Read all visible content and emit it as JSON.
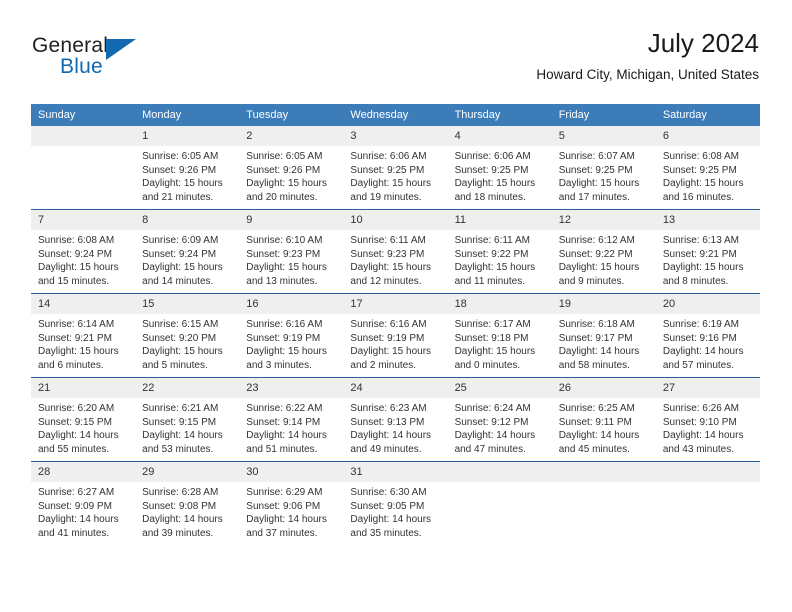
{
  "brand": {
    "name_part1": "General",
    "name_part2": "Blue",
    "logo_icon": "triangle-icon"
  },
  "header": {
    "title": "July 2024",
    "subtitle": "Howard City, Michigan, United States"
  },
  "calendar": {
    "weekday_headers": [
      "Sunday",
      "Monday",
      "Tuesday",
      "Wednesday",
      "Thursday",
      "Friday",
      "Saturday"
    ],
    "accent_color": "#3b7cb9",
    "daynum_band_color": "#efefef",
    "row_divider_color": "#2a6099",
    "weeks": [
      [
        {
          "day": "",
          "empty": true,
          "sunrise": "",
          "sunset": "",
          "daylight_line1": "",
          "daylight_line2": ""
        },
        {
          "day": "1",
          "empty": false,
          "sunrise": "Sunrise: 6:05 AM",
          "sunset": "Sunset: 9:26 PM",
          "daylight_line1": "Daylight: 15 hours",
          "daylight_line2": "and 21 minutes."
        },
        {
          "day": "2",
          "empty": false,
          "sunrise": "Sunrise: 6:05 AM",
          "sunset": "Sunset: 9:26 PM",
          "daylight_line1": "Daylight: 15 hours",
          "daylight_line2": "and 20 minutes."
        },
        {
          "day": "3",
          "empty": false,
          "sunrise": "Sunrise: 6:06 AM",
          "sunset": "Sunset: 9:25 PM",
          "daylight_line1": "Daylight: 15 hours",
          "daylight_line2": "and 19 minutes."
        },
        {
          "day": "4",
          "empty": false,
          "sunrise": "Sunrise: 6:06 AM",
          "sunset": "Sunset: 9:25 PM",
          "daylight_line1": "Daylight: 15 hours",
          "daylight_line2": "and 18 minutes."
        },
        {
          "day": "5",
          "empty": false,
          "sunrise": "Sunrise: 6:07 AM",
          "sunset": "Sunset: 9:25 PM",
          "daylight_line1": "Daylight: 15 hours",
          "daylight_line2": "and 17 minutes."
        },
        {
          "day": "6",
          "empty": false,
          "sunrise": "Sunrise: 6:08 AM",
          "sunset": "Sunset: 9:25 PM",
          "daylight_line1": "Daylight: 15 hours",
          "daylight_line2": "and 16 minutes."
        }
      ],
      [
        {
          "day": "7",
          "empty": false,
          "sunrise": "Sunrise: 6:08 AM",
          "sunset": "Sunset: 9:24 PM",
          "daylight_line1": "Daylight: 15 hours",
          "daylight_line2": "and 15 minutes."
        },
        {
          "day": "8",
          "empty": false,
          "sunrise": "Sunrise: 6:09 AM",
          "sunset": "Sunset: 9:24 PM",
          "daylight_line1": "Daylight: 15 hours",
          "daylight_line2": "and 14 minutes."
        },
        {
          "day": "9",
          "empty": false,
          "sunrise": "Sunrise: 6:10 AM",
          "sunset": "Sunset: 9:23 PM",
          "daylight_line1": "Daylight: 15 hours",
          "daylight_line2": "and 13 minutes."
        },
        {
          "day": "10",
          "empty": false,
          "sunrise": "Sunrise: 6:11 AM",
          "sunset": "Sunset: 9:23 PM",
          "daylight_line1": "Daylight: 15 hours",
          "daylight_line2": "and 12 minutes."
        },
        {
          "day": "11",
          "empty": false,
          "sunrise": "Sunrise: 6:11 AM",
          "sunset": "Sunset: 9:22 PM",
          "daylight_line1": "Daylight: 15 hours",
          "daylight_line2": "and 11 minutes."
        },
        {
          "day": "12",
          "empty": false,
          "sunrise": "Sunrise: 6:12 AM",
          "sunset": "Sunset: 9:22 PM",
          "daylight_line1": "Daylight: 15 hours",
          "daylight_line2": "and 9 minutes."
        },
        {
          "day": "13",
          "empty": false,
          "sunrise": "Sunrise: 6:13 AM",
          "sunset": "Sunset: 9:21 PM",
          "daylight_line1": "Daylight: 15 hours",
          "daylight_line2": "and 8 minutes."
        }
      ],
      [
        {
          "day": "14",
          "empty": false,
          "sunrise": "Sunrise: 6:14 AM",
          "sunset": "Sunset: 9:21 PM",
          "daylight_line1": "Daylight: 15 hours",
          "daylight_line2": "and 6 minutes."
        },
        {
          "day": "15",
          "empty": false,
          "sunrise": "Sunrise: 6:15 AM",
          "sunset": "Sunset: 9:20 PM",
          "daylight_line1": "Daylight: 15 hours",
          "daylight_line2": "and 5 minutes."
        },
        {
          "day": "16",
          "empty": false,
          "sunrise": "Sunrise: 6:16 AM",
          "sunset": "Sunset: 9:19 PM",
          "daylight_line1": "Daylight: 15 hours",
          "daylight_line2": "and 3 minutes."
        },
        {
          "day": "17",
          "empty": false,
          "sunrise": "Sunrise: 6:16 AM",
          "sunset": "Sunset: 9:19 PM",
          "daylight_line1": "Daylight: 15 hours",
          "daylight_line2": "and 2 minutes."
        },
        {
          "day": "18",
          "empty": false,
          "sunrise": "Sunrise: 6:17 AM",
          "sunset": "Sunset: 9:18 PM",
          "daylight_line1": "Daylight: 15 hours",
          "daylight_line2": "and 0 minutes."
        },
        {
          "day": "19",
          "empty": false,
          "sunrise": "Sunrise: 6:18 AM",
          "sunset": "Sunset: 9:17 PM",
          "daylight_line1": "Daylight: 14 hours",
          "daylight_line2": "and 58 minutes."
        },
        {
          "day": "20",
          "empty": false,
          "sunrise": "Sunrise: 6:19 AM",
          "sunset": "Sunset: 9:16 PM",
          "daylight_line1": "Daylight: 14 hours",
          "daylight_line2": "and 57 minutes."
        }
      ],
      [
        {
          "day": "21",
          "empty": false,
          "sunrise": "Sunrise: 6:20 AM",
          "sunset": "Sunset: 9:15 PM",
          "daylight_line1": "Daylight: 14 hours",
          "daylight_line2": "and 55 minutes."
        },
        {
          "day": "22",
          "empty": false,
          "sunrise": "Sunrise: 6:21 AM",
          "sunset": "Sunset: 9:15 PM",
          "daylight_line1": "Daylight: 14 hours",
          "daylight_line2": "and 53 minutes."
        },
        {
          "day": "23",
          "empty": false,
          "sunrise": "Sunrise: 6:22 AM",
          "sunset": "Sunset: 9:14 PM",
          "daylight_line1": "Daylight: 14 hours",
          "daylight_line2": "and 51 minutes."
        },
        {
          "day": "24",
          "empty": false,
          "sunrise": "Sunrise: 6:23 AM",
          "sunset": "Sunset: 9:13 PM",
          "daylight_line1": "Daylight: 14 hours",
          "daylight_line2": "and 49 minutes."
        },
        {
          "day": "25",
          "empty": false,
          "sunrise": "Sunrise: 6:24 AM",
          "sunset": "Sunset: 9:12 PM",
          "daylight_line1": "Daylight: 14 hours",
          "daylight_line2": "and 47 minutes."
        },
        {
          "day": "26",
          "empty": false,
          "sunrise": "Sunrise: 6:25 AM",
          "sunset": "Sunset: 9:11 PM",
          "daylight_line1": "Daylight: 14 hours",
          "daylight_line2": "and 45 minutes."
        },
        {
          "day": "27",
          "empty": false,
          "sunrise": "Sunrise: 6:26 AM",
          "sunset": "Sunset: 9:10 PM",
          "daylight_line1": "Daylight: 14 hours",
          "daylight_line2": "and 43 minutes."
        }
      ],
      [
        {
          "day": "28",
          "empty": false,
          "sunrise": "Sunrise: 6:27 AM",
          "sunset": "Sunset: 9:09 PM",
          "daylight_line1": "Daylight: 14 hours",
          "daylight_line2": "and 41 minutes."
        },
        {
          "day": "29",
          "empty": false,
          "sunrise": "Sunrise: 6:28 AM",
          "sunset": "Sunset: 9:08 PM",
          "daylight_line1": "Daylight: 14 hours",
          "daylight_line2": "and 39 minutes."
        },
        {
          "day": "30",
          "empty": false,
          "sunrise": "Sunrise: 6:29 AM",
          "sunset": "Sunset: 9:06 PM",
          "daylight_line1": "Daylight: 14 hours",
          "daylight_line2": "and 37 minutes."
        },
        {
          "day": "31",
          "empty": false,
          "sunrise": "Sunrise: 6:30 AM",
          "sunset": "Sunset: 9:05 PM",
          "daylight_line1": "Daylight: 14 hours",
          "daylight_line2": "and 35 minutes."
        },
        {
          "day": "",
          "empty": true,
          "sunrise": "",
          "sunset": "",
          "daylight_line1": "",
          "daylight_line2": ""
        },
        {
          "day": "",
          "empty": true,
          "sunrise": "",
          "sunset": "",
          "daylight_line1": "",
          "daylight_line2": ""
        },
        {
          "day": "",
          "empty": true,
          "sunrise": "",
          "sunset": "",
          "daylight_line1": "",
          "daylight_line2": ""
        }
      ]
    ]
  }
}
